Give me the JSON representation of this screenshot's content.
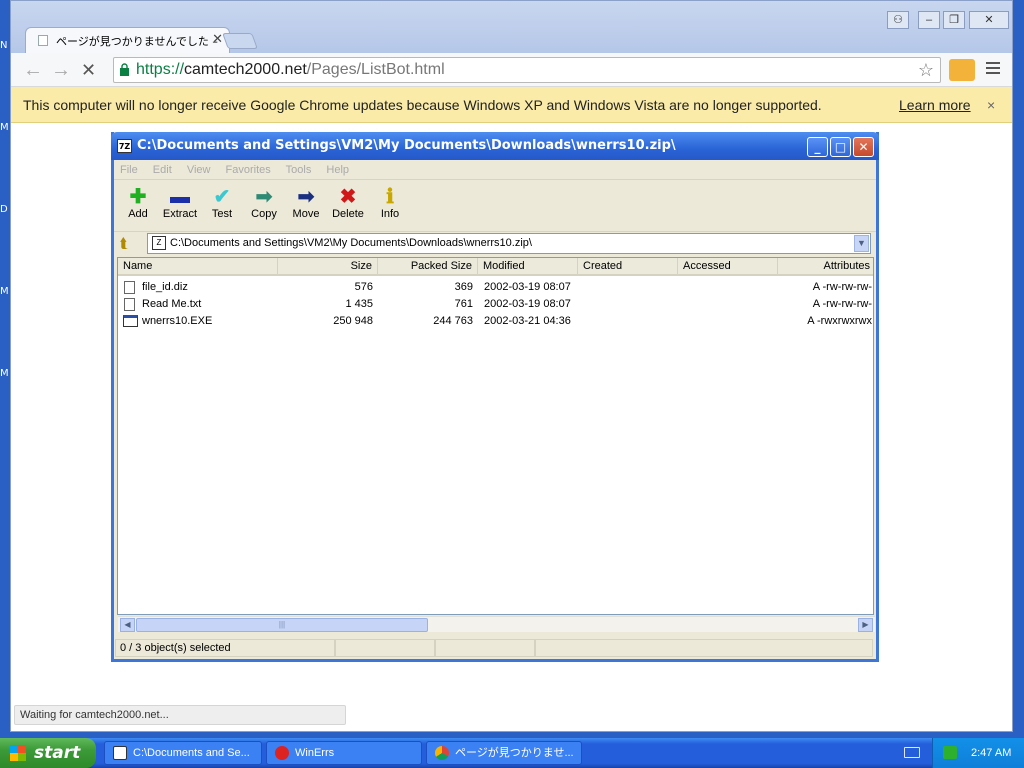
{
  "desktop": {
    "side_letters": [
      "N",
      "M",
      "D",
      "M",
      "M"
    ]
  },
  "chrome": {
    "tab_title": "ページが見つかりませんでした – ",
    "tab_close": "✕",
    "window_controls": [
      "⚇",
      "–",
      "❐",
      "✕"
    ],
    "url_protocol": "https://",
    "url_host": "camtech2000.net",
    "url_path": "/Pages/ListBot.html",
    "infobar_text": "This computer will no longer receive Google Chrome updates because Windows XP and Windows Vista are no longer supported.",
    "infobar_link": "Learn more",
    "infobar_close": "×",
    "status_text": "Waiting for camtech2000.net..."
  },
  "sevenzip": {
    "app_icon_text": "7Z",
    "title": "C:\\Documents and Settings\\VM2\\My Documents\\Downloads\\wnerrs10.zip\\",
    "menu": [
      "File",
      "Edit",
      "View",
      "Favorites",
      "Tools",
      "Help"
    ],
    "tools": [
      {
        "label": "Add",
        "icon": "plus-icon",
        "glyph": "✚",
        "color": "#21b021"
      },
      {
        "label": "Extract",
        "icon": "minus-icon",
        "glyph": "▬",
        "color": "#1a2fa8"
      },
      {
        "label": "Test",
        "icon": "check-icon",
        "glyph": "✔",
        "color": "#3cc8d0"
      },
      {
        "label": "Copy",
        "icon": "copy-arrow-icon",
        "glyph": "➡",
        "color": "#2e8a75"
      },
      {
        "label": "Move",
        "icon": "move-arrow-icon",
        "glyph": "➡",
        "color": "#1a2f80"
      },
      {
        "label": "Delete",
        "icon": "delete-x-icon",
        "glyph": "✖",
        "color": "#d01818"
      },
      {
        "label": "Info",
        "icon": "info-icon",
        "glyph": "ℹ",
        "color": "#c8a800"
      }
    ],
    "address": "C:\\Documents and Settings\\VM2\\My Documents\\Downloads\\wnerrs10.zip\\",
    "columns": [
      "Name",
      "Size",
      "Packed Size",
      "Modified",
      "Created",
      "Accessed",
      "Attributes"
    ],
    "files": [
      {
        "name": "file_id.diz",
        "size": "576",
        "packed": "369",
        "modified": "2002-03-19 08:07",
        "created": "",
        "accessed": "",
        "attributes": "A -rw-rw-rw-",
        "type": "text"
      },
      {
        "name": "Read Me.txt",
        "size": "1 435",
        "packed": "761",
        "modified": "2002-03-19 08:07",
        "created": "",
        "accessed": "",
        "attributes": "A -rw-rw-rw-",
        "type": "text"
      },
      {
        "name": "wnerrs10.EXE",
        "size": "250 948",
        "packed": "244 763",
        "modified": "2002-03-21 04:36",
        "created": "",
        "accessed": "",
        "attributes": "A -rwxrwxrwx",
        "type": "exe"
      }
    ],
    "status": "0 / 3 object(s) selected"
  },
  "taskbar": {
    "start_label": "start",
    "tasks": [
      {
        "label": "C:\\Documents and Se...",
        "icon": "sevenzip-icon"
      },
      {
        "label": "WinErrs",
        "icon": "error-icon"
      },
      {
        "label": "ページが見つかりませ...",
        "icon": "chrome-icon"
      }
    ],
    "clock": "2:47 AM"
  }
}
